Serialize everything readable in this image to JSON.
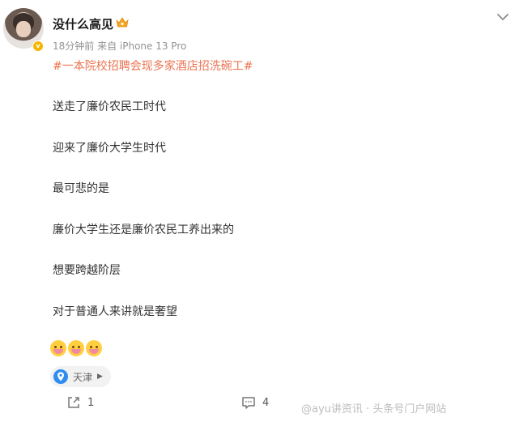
{
  "post": {
    "author": "没什么高见",
    "meta": "18分钟前  来自 iPhone 13 Pro",
    "topic": "#一本院校招聘会现多家酒店招洗碗工#",
    "lines": [
      "送走了廉价农民工时代",
      "迎来了廉价大学生时代",
      "最可悲的是",
      "廉价大学生还是廉价农民工养出来的",
      "想要跨越阶层",
      "对于普通人来讲就是奢望"
    ],
    "emoji_icons": [
      "crying-face-icon",
      "crying-face-icon",
      "crying-face-icon"
    ],
    "location": "天津"
  },
  "actions": {
    "share_count": "1",
    "comment_count": "4"
  },
  "watermark": "@ayu讲资讯 · 头条号门户网站",
  "colors": {
    "topic": "#eb7350",
    "verified_badge": "#f7b500",
    "location_pin": "#2f8cf0"
  }
}
